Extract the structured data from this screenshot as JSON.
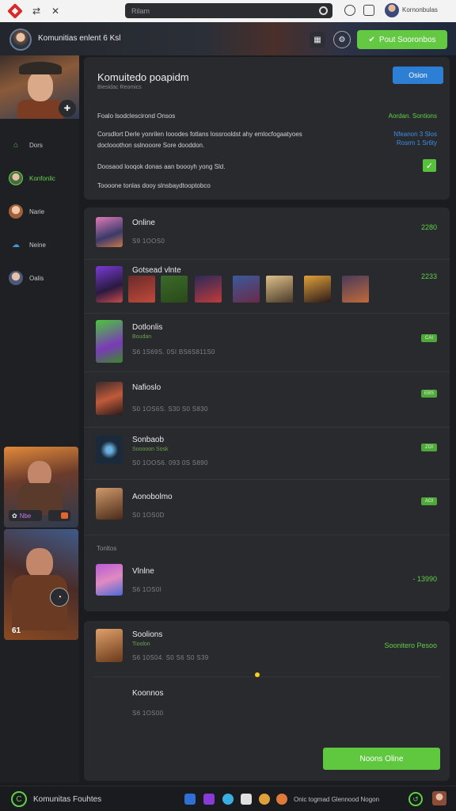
{
  "browser": {
    "address": "Rilam",
    "user": "Kornonbulas"
  },
  "header": {
    "title": "Komunitias enlent 6 Ksl",
    "cta_label": "Pout Sooronbos"
  },
  "sidebar": {
    "items": [
      {
        "label": "Dors",
        "icon": "home-icon",
        "color": "#4fbf3a"
      },
      {
        "label": "Konfonlic",
        "icon": "avatar-icon",
        "color": "#66d14a"
      },
      {
        "label": "Narie",
        "icon": "avatar-icon",
        "color": "#e0a070"
      },
      {
        "label": "Neine",
        "icon": "group-icon",
        "color": "#3c9ad6"
      },
      {
        "label": "Oalis",
        "icon": "avatar-icon",
        "color": "#9ab0d0"
      }
    ],
    "card1_label": "Nbe",
    "card2_number": "61"
  },
  "panel1": {
    "title": "Komuitedo poapidm",
    "subtitle": "Biesidac Reomics",
    "button": "Osion",
    "line1": "Foalo lsodclescirond Onsos",
    "green_note": "Aordan. Sontions",
    "line2": "Corsdlort Derle yonrilen Iooodes fotlans lossrooldst ahy emlocfogaatyoes",
    "line3": "doclooothon sslnooore Sore dooddon.",
    "blue_note1": "Nfeanon 3 Slos",
    "blue_note2": "Rosrm 1 Sr6ty",
    "line4": "Doosaod looqok donas aan boooyh yong Sld.",
    "line5": "Toooone tonlas dooy slnsbaydtooptobco"
  },
  "rows": [
    {
      "name": "Online",
      "meta": "S9 1OOS0",
      "value": "2280"
    },
    {
      "name": "Gotsead vlnte",
      "meta": "",
      "value": "2233"
    },
    {
      "name": "Dotlonlis",
      "meta_green": "Boudan",
      "meta": "S6 1S69S. 0SI BS6S811S0",
      "pill": "CAI"
    },
    {
      "name": "Nafioslo",
      "meta": "S0 1OS6S. S30 S0 S830",
      "pill": "EBS"
    },
    {
      "name": "Sonbaob",
      "meta_green": "Sooooon Sosk",
      "meta": "S0 1OOS6. 093 0S S890",
      "pill": "ZOI"
    },
    {
      "name": "Aonobolmo",
      "meta": "S0 1OS0D",
      "pill": "AOI"
    },
    {
      "name": "Vlnlne",
      "meta": "S6 1OS0I",
      "value": "- 13990"
    }
  ],
  "section_label": "Tonltos",
  "panel3": {
    "row1_name": "Soolions",
    "row1_meta_green": "Tioolon",
    "row1_meta": "S6 10S04. S0 S6 S0 S39",
    "row1_value": "Soonitero Pesoo",
    "row2_name": "Koonnos",
    "row2_meta": "S6 1OS00",
    "button": "Noons Oline"
  },
  "bottombar": {
    "title": "Komunitas Fouhtes",
    "status": "Onic togmad Glennood Nogon"
  }
}
